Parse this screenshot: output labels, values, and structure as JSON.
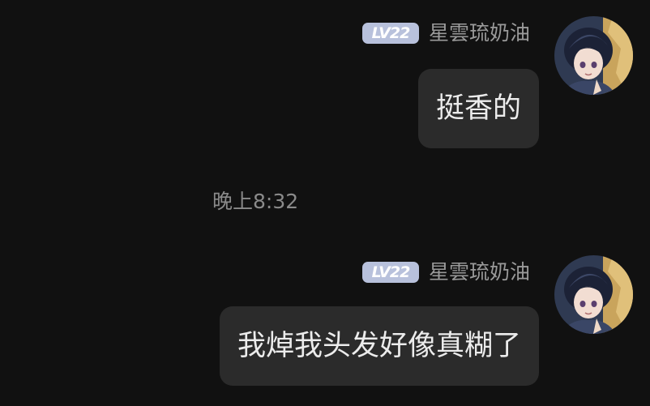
{
  "chat": {
    "messages": [
      {
        "level_badge": "LV22",
        "username": "星雲琉奶油",
        "text": "挺香的",
        "avatar_icon": "user-avatar-anime"
      },
      {
        "level_badge": "LV22",
        "username": "星雲琉奶油",
        "text": "我焯我头发好像真糊了",
        "avatar_icon": "user-avatar-anime"
      }
    ],
    "timestamp": "晚上8:32"
  },
  "colors": {
    "background": "#111111",
    "bubble": "#2b2b2b",
    "badge": "#b8c1dc",
    "username": "#9a9a9a",
    "timestamp": "#8a8a8a"
  }
}
